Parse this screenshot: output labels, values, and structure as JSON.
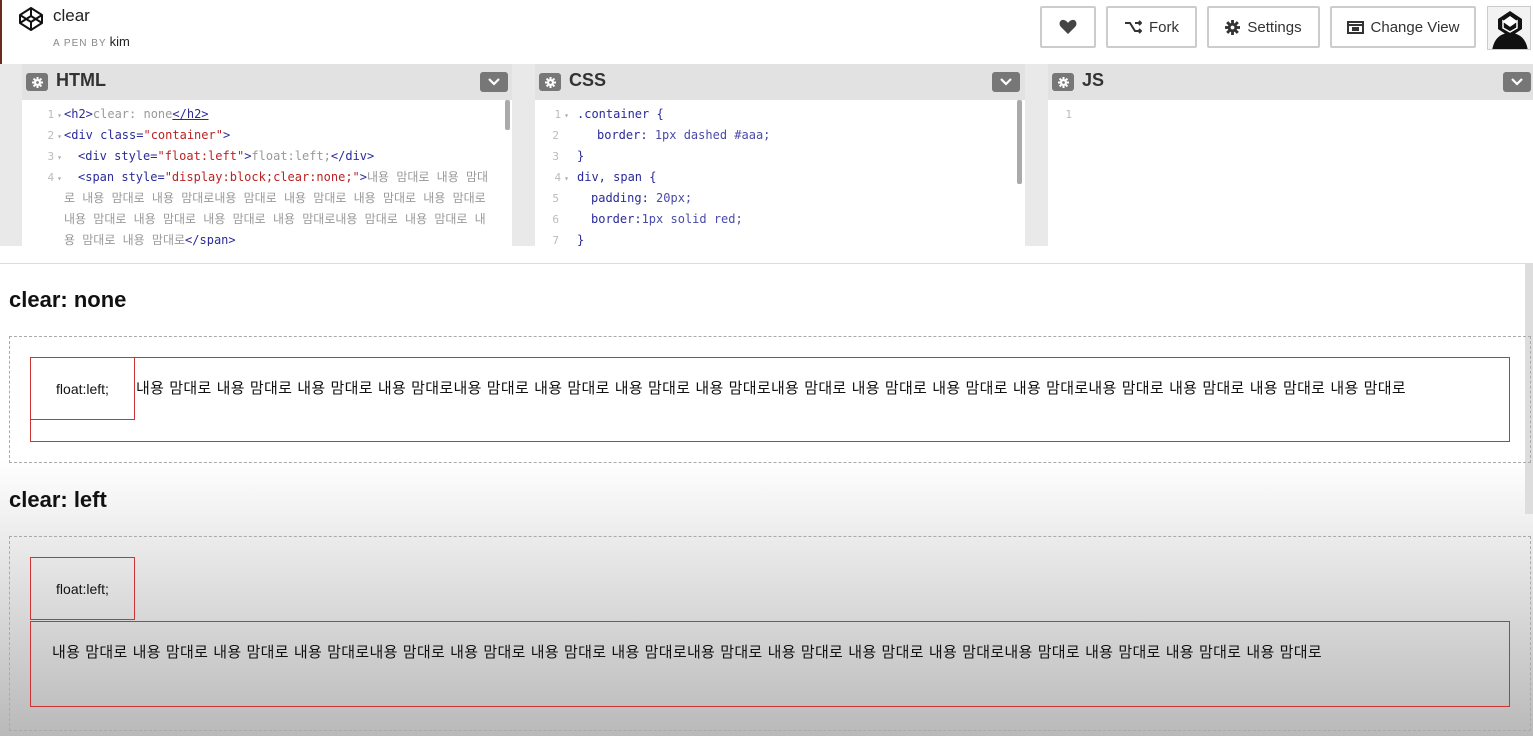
{
  "pen": {
    "title": "clear",
    "by_label": "A PEN BY",
    "author": "kim"
  },
  "toolbar": {
    "fork_label": "Fork",
    "settings_label": "Settings",
    "change_view_label": "Change View"
  },
  "editors": {
    "html": {
      "title": "HTML",
      "gutter": [
        "1",
        "2",
        "3",
        "4"
      ],
      "l1": {
        "open": "<h2>",
        "text": "clear: none",
        "close": "</h2>"
      },
      "l2": {
        "a": "<div class=",
        "str": "\"container\"",
        "b": ">"
      },
      "l3": {
        "a": "<div style=",
        "str": "\"float:left\"",
        "b": ">",
        "text": "float:left;",
        "close": "</div>"
      },
      "l4": {
        "a": "<span style=",
        "str": "\"display:block;clear:none;\"",
        "b": ">",
        "text": "내용 맘대로 내용 맘대로 내용 맘대로 내용 맘대로내용 맘대로 내용 맘대로 내용 맘대로 내용 맘대로내용 맘대로 내용 맘대로 내용 맘대로 내용 맘대로내용 맘대로 내용 맘대로 내용 맘대로 내용 맘대로",
        "close": "</span>"
      }
    },
    "css": {
      "title": "CSS",
      "gutter": [
        "1",
        "2",
        "3",
        "4",
        "5",
        "6",
        "7"
      ],
      "l1": {
        "sel": ".container {"
      },
      "l2": {
        "prop": "border:",
        "val": "1px dashed #aaa;"
      },
      "l3": {
        "text": "}"
      },
      "l4": {
        "sel": "div, span {"
      },
      "l5": {
        "prop": "padding:",
        "val": "20px;"
      },
      "l6": {
        "prop": "border:",
        "val": "1px solid red;"
      },
      "l7": {
        "text": "}"
      }
    },
    "js": {
      "title": "JS",
      "gutter": [
        "1"
      ]
    }
  },
  "result": {
    "section1": {
      "heading": "clear: none",
      "float_text": "float:left;",
      "span_text": "내용 맘대로 내용 맘대로 내용 맘대로 내용 맘대로내용 맘대로 내용 맘대로 내용 맘대로 내용 맘대로내용 맘대로 내용 맘대로 내용 맘대로 내용 맘대로내용 맘대로 내용 맘대로 내용 맘대로 내용 맘대로"
    },
    "section2": {
      "heading": "clear: left",
      "float_text": "float:left;",
      "span_text": "내용 맘대로 내용 맘대로 내용 맘대로 내용 맘대로내용 맘대로 내용 맘대로 내용 맘대로 내용 맘대로내용 맘대로 내용 맘대로 내용 맘대로 내용 맘대로내용 맘대로 내용 맘대로 내용 맘대로 내용 맘대로"
    }
  },
  "icons": {
    "logo": "codepen-logo-icon",
    "heart": "heart-icon",
    "fork": "fork-icon",
    "settings": "gear-icon",
    "change_view": "change-view-icon",
    "editor_settings": "gear-icon",
    "editor_dropdown": "chevron-down-icon"
  },
  "colors": {
    "border_red": "#cc3333",
    "dashed": "#aaaaaa",
    "editor_header": "#e2e2e2",
    "tag_blue": "#2a2a9a",
    "string_red": "#bb2222"
  }
}
